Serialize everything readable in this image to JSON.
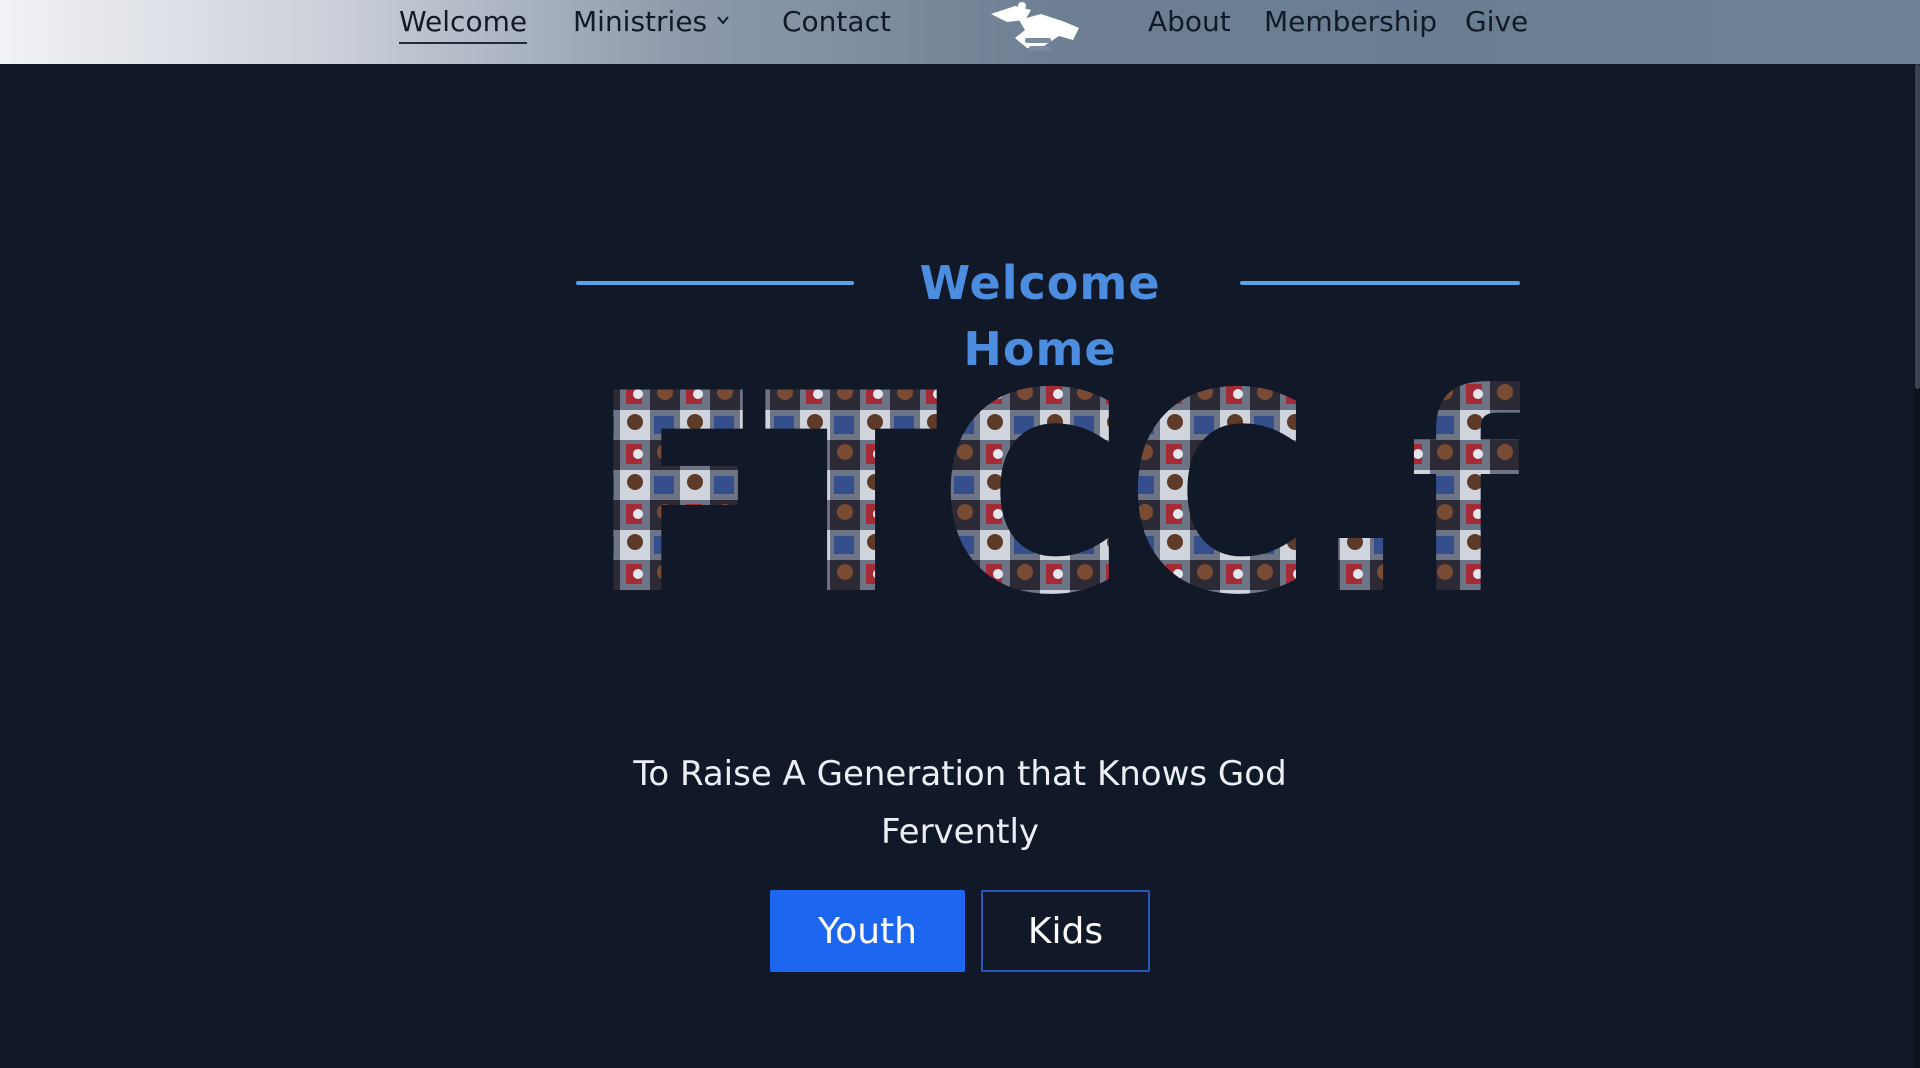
{
  "nav": {
    "left_items": [
      {
        "label": "Welcome",
        "active": true
      },
      {
        "label": "Ministries",
        "has_dropdown": true
      },
      {
        "label": "Contact"
      }
    ],
    "right_items": [
      {
        "label": "About"
      },
      {
        "label": "Membership"
      },
      {
        "label": "Give"
      }
    ],
    "logo_icon": "helping-hands-icon"
  },
  "hero": {
    "heading": "Welcome Home",
    "brand_text": "FTCC.f",
    "tagline_line1": "To Raise A Generation that Knows God",
    "tagline_line2": "Fervently"
  },
  "buttons": {
    "youth": "Youth",
    "kids": "Kids"
  },
  "colors": {
    "background": "#111828",
    "accent": "#4d8ddf",
    "primary_button": "#1d67f0"
  }
}
